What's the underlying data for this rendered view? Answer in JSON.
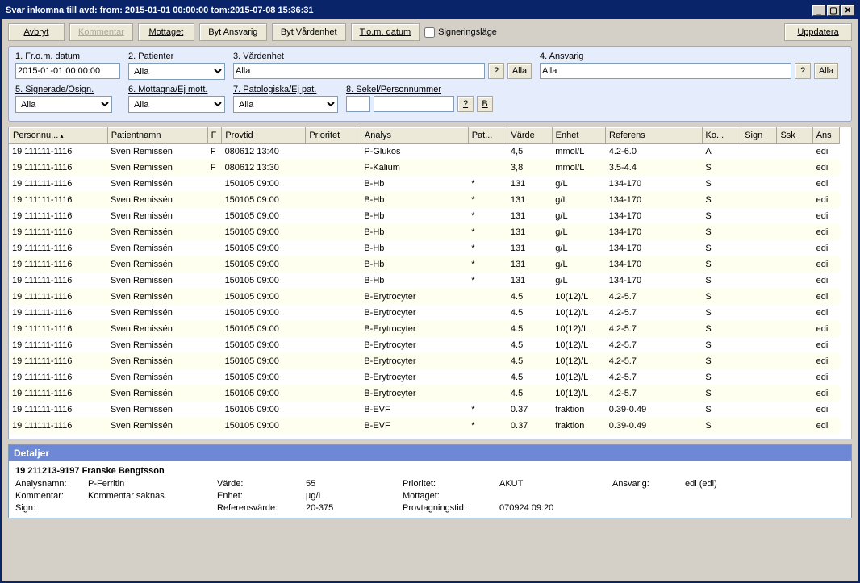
{
  "window": {
    "title": "Svar inkomna till avd:  from: 2015-01-01 00:00:00 tom:2015-07-08 15:36:31"
  },
  "toolbar": {
    "avbryt": "Avbryt",
    "kommentar": "Kommentar",
    "mottaget": "Mottaget",
    "byt_ansvarig": "Byt Ansvarig",
    "byt_vardenhet": "Byt Vårdenhet",
    "tom_datum": "T.o.m. datum",
    "signeringslage": "Signeringsläge",
    "uppdatera": "Uppdatera"
  },
  "filters": {
    "from_label": "1. Fr.o.m. datum",
    "from_value": "2015-01-01 00:00:00",
    "patienter_label": "2. Patienter",
    "patienter_value": "Alla",
    "vardenhet_label": "3. Vårdenhet",
    "vardenhet_value": "Alla",
    "vardenhet_btn": "?",
    "vardenhet_alla": "Alla",
    "ansvarig_label": "4. Ansvarig",
    "ansvarig_value": "Alla",
    "ansvarig_btn": "?",
    "ansvarig_alla": "Alla",
    "sign_label": "5. Signerade/Osign.",
    "sign_value": "Alla",
    "mottag_label": "6. Mottagna/Ej mott.",
    "mottag_value": "Alla",
    "patol_label": "7. Patologiska/Ej pat.",
    "patol_value": "Alla",
    "sekel_label": "8. Sekel/Personnummer",
    "sekel_a": "",
    "sekel_b": "",
    "qbtn": "?",
    "bbtn": "B"
  },
  "columns": [
    "Personnu...",
    "Patientnamn",
    "F",
    "Provtid",
    "Prioritet",
    "Analys",
    "Pat...",
    "Värde",
    "Enhet",
    "Referens",
    "Ko...",
    "Sign",
    "Ssk",
    "Ans"
  ],
  "rows": [
    {
      "pn": "19 111111-1116",
      "namn": "Sven Remissén",
      "f": "F",
      "provtid": "080612 13:40",
      "prio": "",
      "analys": "P-Glukos",
      "pat": "",
      "varde": "4,5",
      "enhet": "mmol/L",
      "ref": "4.2-6.0",
      "ko": "A",
      "sign": "",
      "ssk": "",
      "ans": "edi"
    },
    {
      "pn": "19 111111-1116",
      "namn": "Sven Remissén",
      "f": "F",
      "provtid": "080612 13:30",
      "prio": "",
      "analys": "P-Kalium",
      "pat": "",
      "varde": "3,8",
      "enhet": "mmol/L",
      "ref": "3.5-4.4",
      "ko": "S",
      "sign": "",
      "ssk": "",
      "ans": "edi"
    },
    {
      "pn": "19 111111-1116",
      "namn": "Sven Remissén",
      "f": "",
      "provtid": "150105 09:00",
      "prio": "",
      "analys": "B-Hb",
      "pat": "*",
      "varde": "131",
      "enhet": "g/L",
      "ref": "134-170",
      "ko": "S",
      "sign": "",
      "ssk": "",
      "ans": "edi"
    },
    {
      "pn": "19 111111-1116",
      "namn": "Sven Remissén",
      "f": "",
      "provtid": "150105 09:00",
      "prio": "",
      "analys": "B-Hb",
      "pat": "*",
      "varde": "131",
      "enhet": "g/L",
      "ref": "134-170",
      "ko": "S",
      "sign": "",
      "ssk": "",
      "ans": "edi"
    },
    {
      "pn": "19 111111-1116",
      "namn": "Sven Remissén",
      "f": "",
      "provtid": "150105 09:00",
      "prio": "",
      "analys": "B-Hb",
      "pat": "*",
      "varde": "131",
      "enhet": "g/L",
      "ref": "134-170",
      "ko": "S",
      "sign": "",
      "ssk": "",
      "ans": "edi"
    },
    {
      "pn": "19 111111-1116",
      "namn": "Sven Remissén",
      "f": "",
      "provtid": "150105 09:00",
      "prio": "",
      "analys": "B-Hb",
      "pat": "*",
      "varde": "131",
      "enhet": "g/L",
      "ref": "134-170",
      "ko": "S",
      "sign": "",
      "ssk": "",
      "ans": "edi"
    },
    {
      "pn": "19 111111-1116",
      "namn": "Sven Remissén",
      "f": "",
      "provtid": "150105 09:00",
      "prio": "",
      "analys": "B-Hb",
      "pat": "*",
      "varde": "131",
      "enhet": "g/L",
      "ref": "134-170",
      "ko": "S",
      "sign": "",
      "ssk": "",
      "ans": "edi"
    },
    {
      "pn": "19 111111-1116",
      "namn": "Sven Remissén",
      "f": "",
      "provtid": "150105 09:00",
      "prio": "",
      "analys": "B-Hb",
      "pat": "*",
      "varde": "131",
      "enhet": "g/L",
      "ref": "134-170",
      "ko": "S",
      "sign": "",
      "ssk": "",
      "ans": "edi"
    },
    {
      "pn": "19 111111-1116",
      "namn": "Sven Remissén",
      "f": "",
      "provtid": "150105 09:00",
      "prio": "",
      "analys": "B-Hb",
      "pat": "*",
      "varde": "131",
      "enhet": "g/L",
      "ref": "134-170",
      "ko": "S",
      "sign": "",
      "ssk": "",
      "ans": "edi"
    },
    {
      "pn": "19 111111-1116",
      "namn": "Sven Remissén",
      "f": "",
      "provtid": "150105 09:00",
      "prio": "",
      "analys": "B-Erytrocyter",
      "pat": "",
      "varde": "4.5",
      "enhet": "10(12)/L",
      "ref": "4.2-5.7",
      "ko": "S",
      "sign": "",
      "ssk": "",
      "ans": "edi"
    },
    {
      "pn": "19 111111-1116",
      "namn": "Sven Remissén",
      "f": "",
      "provtid": "150105 09:00",
      "prio": "",
      "analys": "B-Erytrocyter",
      "pat": "",
      "varde": "4.5",
      "enhet": "10(12)/L",
      "ref": "4.2-5.7",
      "ko": "S",
      "sign": "",
      "ssk": "",
      "ans": "edi"
    },
    {
      "pn": "19 111111-1116",
      "namn": "Sven Remissén",
      "f": "",
      "provtid": "150105 09:00",
      "prio": "",
      "analys": "B-Erytrocyter",
      "pat": "",
      "varde": "4.5",
      "enhet": "10(12)/L",
      "ref": "4.2-5.7",
      "ko": "S",
      "sign": "",
      "ssk": "",
      "ans": "edi"
    },
    {
      "pn": "19 111111-1116",
      "namn": "Sven Remissén",
      "f": "",
      "provtid": "150105 09:00",
      "prio": "",
      "analys": "B-Erytrocyter",
      "pat": "",
      "varde": "4.5",
      "enhet": "10(12)/L",
      "ref": "4.2-5.7",
      "ko": "S",
      "sign": "",
      "ssk": "",
      "ans": "edi"
    },
    {
      "pn": "19 111111-1116",
      "namn": "Sven Remissén",
      "f": "",
      "provtid": "150105 09:00",
      "prio": "",
      "analys": "B-Erytrocyter",
      "pat": "",
      "varde": "4.5",
      "enhet": "10(12)/L",
      "ref": "4.2-5.7",
      "ko": "S",
      "sign": "",
      "ssk": "",
      "ans": "edi"
    },
    {
      "pn": "19 111111-1116",
      "namn": "Sven Remissén",
      "f": "",
      "provtid": "150105 09:00",
      "prio": "",
      "analys": "B-Erytrocyter",
      "pat": "",
      "varde": "4.5",
      "enhet": "10(12)/L",
      "ref": "4.2-5.7",
      "ko": "S",
      "sign": "",
      "ssk": "",
      "ans": "edi"
    },
    {
      "pn": "19 111111-1116",
      "namn": "Sven Remissén",
      "f": "",
      "provtid": "150105 09:00",
      "prio": "",
      "analys": "B-Erytrocyter",
      "pat": "",
      "varde": "4.5",
      "enhet": "10(12)/L",
      "ref": "4.2-5.7",
      "ko": "S",
      "sign": "",
      "ssk": "",
      "ans": "edi"
    },
    {
      "pn": "19 111111-1116",
      "namn": "Sven Remissén",
      "f": "",
      "provtid": "150105 09:00",
      "prio": "",
      "analys": "B-EVF",
      "pat": "*",
      "varde": "0.37",
      "enhet": "fraktion",
      "ref": "0.39-0.49",
      "ko": "S",
      "sign": "",
      "ssk": "",
      "ans": "edi"
    },
    {
      "pn": "19 111111-1116",
      "namn": "Sven Remissén",
      "f": "",
      "provtid": "150105 09:00",
      "prio": "",
      "analys": "B-EVF",
      "pat": "*",
      "varde": "0.37",
      "enhet": "fraktion",
      "ref": "0.39-0.49",
      "ko": "S",
      "sign": "",
      "ssk": "",
      "ans": "edi"
    }
  ],
  "details": {
    "header": "Detaljer",
    "title": "19 211213-9197 Franske Bengtsson",
    "analysnamn_l": "Analysnamn:",
    "analysnamn_v": "P-Ferritin",
    "varde_l": "Värde:",
    "varde_v": "55",
    "prioritet_l": "Prioritet:",
    "prioritet_v": "AKUT",
    "ansvarig_l": "Ansvarig:",
    "ansvarig_v": "edi (edi)",
    "kommentar_l": "Kommentar:",
    "kommentar_v": "Kommentar saknas.",
    "enhet_l": "Enhet:",
    "enhet_v": "µg/L",
    "mottaget_l": "Mottaget:",
    "mottaget_v": "",
    "sign_l": "Sign:",
    "sign_v": "",
    "refvarde_l": "Referensvärde:",
    "refvarde_v": "20-375",
    "provtid_l": "Provtagningstid:",
    "provtid_v": "070924 09:20"
  }
}
